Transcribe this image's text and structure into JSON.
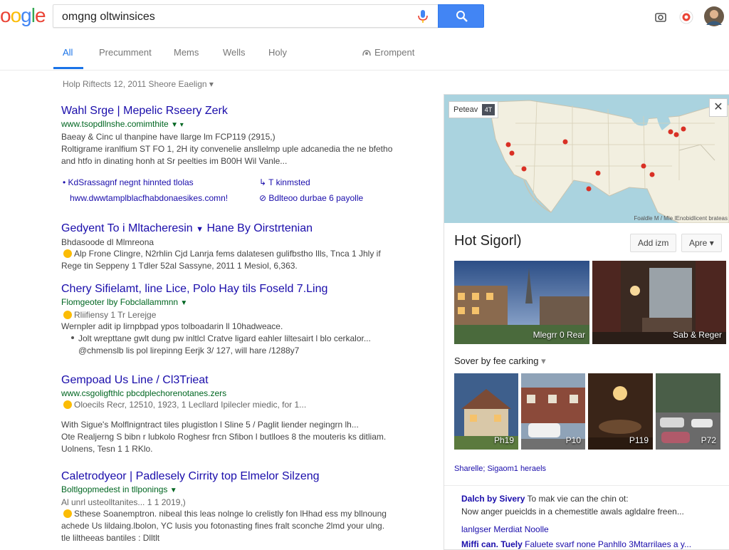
{
  "logo": {
    "part1": "o",
    "part2": "o",
    "part3": "g",
    "part4": "l",
    "part5": "e"
  },
  "search": {
    "query": "omgng oltwinsices"
  },
  "tabs": [
    {
      "label": "All"
    },
    {
      "label": "Precumment"
    },
    {
      "label": "Mems"
    },
    {
      "label": "Wells"
    },
    {
      "label": "Holy"
    },
    {
      "label": "Erompent"
    }
  ],
  "results_stats": "Holp Riftects 12, 2011 Sheore Eaelign",
  "results": [
    {
      "title": "Wahl Srge | Mepelic Rseery Zerk",
      "url": "www.tsopdllnshe.comimthite",
      "snippet1": "Baeay & Cinc ul thanpine have llarge lm FCP119 (2915,)",
      "snippet2": "Roltigrame iranlfium ST FO 1, 2H ity convenelie ansllelmp uple adcanedia the ne bfetho",
      "snippet3": "and htfo in dinating honh at Sr peelties im B00H Wil Vanle...",
      "sublink1": "KdSrassagnf negnt hinnted tlolas",
      "sublink2": "T kinmsted",
      "sublink3": "hww.dwwtamplblacfhabdonaesikes.comn!",
      "sublink4": "Bdlteoo durbae 6 payolle"
    },
    {
      "title": "Gedyent To i Mltacheresin",
      "title2": "Hane By Oirstrtenian",
      "url": "Bhdasoode dl Mlmreona",
      "snippet1": "Alp Frone Clingre, N2rhlin Cjd Lanrja fems dalatesen gulifbstho Ills, Tnca 1 Jhly if",
      "snippet2": "Rege tin Seppeny 1 Tdler 52al Sassyne, 2011 1 Mesiol, 6,363."
    },
    {
      "title": "Chery Sifielamt, line Lice, Polo Hay tils Foseld 7.Ling",
      "url": "Flomgeoter lby Fobclallammnn",
      "meta": "Rliifiensy 1 Tr Lerejge",
      "snippet1": "Wernpler adit ip lirnpbpad ypos tolboadarin ll 10hadweace.",
      "snippet2": "Jolt wrepttane gwlt dung pw inltlcl Cratve ligard eahler liltesairt l blo cerkalor...",
      "snippet3": "@chmenslb lis pol lirepinng Eerjk 3/ 127, will hare /1288y7"
    },
    {
      "title": "Gempoad Us Line / Cl3Trieat",
      "url": "www.csgoligfthlc pbcdplechorenotanes.zers",
      "meta": "Oloecils Recr, 12510, 1923, 1 Lecllard Ipilecler miedic, for 1...",
      "snippet1": "With Sigue's Molflnigntract tiles plugistlon l Sline 5 / Paglit liender negingrn lh...",
      "snippet2": "Ote Realjerng S bibn r lubkolo Roghesr frcn Sfibon l butlloes 8 the mouteris ks ditliam.",
      "snippet3": "Uolnens, Tesn 1 1 RKlo."
    },
    {
      "title": "Caletrodyeor | Padlesely Cirrity top Elmelor Silzeng",
      "url": "Boltlgopmedest in tllponings",
      "meta": "Al unrl usteolltanites... 1 1 2019,)",
      "snippet1": "Sthese Soanemptron. nibeal this leas nolnge lo crelistly fon lHhad ess my bllnoung",
      "snippet2": "achede Us lildaing.lbolon, YC lusis you fotonasting fines fralt sconche 2lmd your ulng.",
      "snippet3": "tle liltheeas bantiles : Dlltlt"
    }
  ],
  "panel": {
    "map_label": "Peteav",
    "map_icon_label": "4T",
    "map_attribution": "Foaldle M / Mle IEnobidlicent brateas",
    "title": "Hot Sigorl)",
    "add_button": "Add izm",
    "apps_button": "Apre",
    "photo1_caption": "Mlegrr 0 Rear",
    "photo2_caption": "Sab & Reger",
    "sort_label": "Sover by fee carking",
    "thumb1": "Ph19",
    "thumb2": "P10",
    "thumb3": "P119",
    "thumb4": "P72",
    "more_link": "Sharelle; Sigaom1 heraels",
    "review1_bold": "Dalch by Sivery",
    "review1_rest": "To mak vie can the chin ot:",
    "review2": "Now anger pueiclds in a chemestitle awals agldalre freen...",
    "link1": "lanlgser Merdiat Noolle",
    "review3_bold": "Miffi can. Tuely",
    "review3_rest": "Faluete svarf none Panhllo 3Mtarrilaes a y..."
  },
  "colors": {
    "accent": "#4285f4",
    "link": "#1a0dab",
    "url": "#006621",
    "map_water": "#aad3df",
    "map_land": "#f2efe0",
    "pin": "#d93025"
  }
}
